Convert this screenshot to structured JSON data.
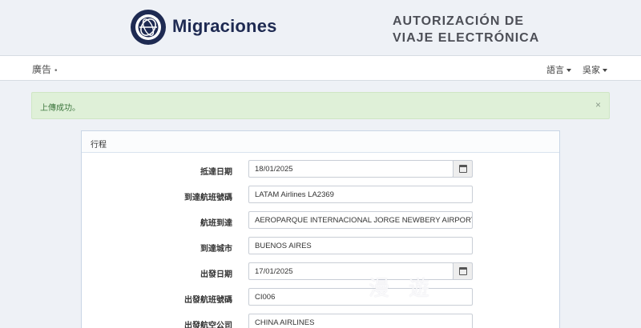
{
  "header": {
    "brand": "Migraciones",
    "eta_line1": "AUTORIZACIÓN DE",
    "eta_line2": "VIAJE ELECTRÓNICA"
  },
  "navbar": {
    "left_label": "廣告",
    "left_dot": "•",
    "language_label": "語言",
    "user_label": "吳家"
  },
  "alert": {
    "message": "上傳成功。",
    "close": "×"
  },
  "panel": {
    "title": "行程",
    "rows": [
      {
        "label": "抵達日期",
        "value": "18/01/2025"
      },
      {
        "label": "到達航班號碼",
        "value": "LATAM Airlines LA2369"
      },
      {
        "label": "航班到達",
        "value": "AEROPARQUE INTERNACIONAL JORGE NEWBERY AIRPORT,IA"
      },
      {
        "label": "到達城市",
        "value": "BUENOS AIRES"
      },
      {
        "label": "出發日期",
        "value": "17/01/2025"
      },
      {
        "label": "出發航班號碼",
        "value": "CI006"
      },
      {
        "label": "出發航空公司",
        "value": "CHINA AIRLINES"
      }
    ]
  },
  "watermark": "漫遊"
}
